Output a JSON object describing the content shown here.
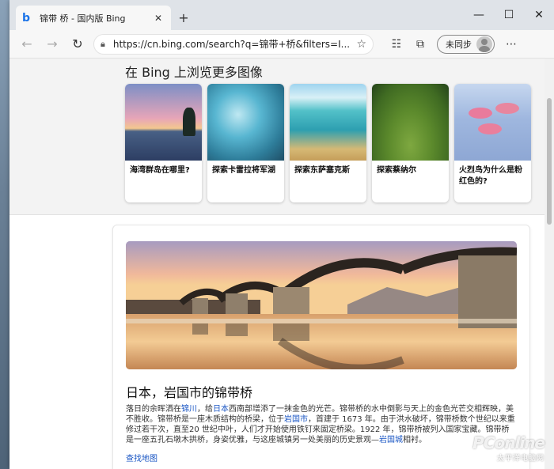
{
  "browser": {
    "tab_title": "锦带 桥 - 国内版 Bing",
    "new_tab": "+",
    "controls": {
      "minimize": "—",
      "maximize": "☐",
      "close": "✕"
    }
  },
  "toolbar": {
    "back": "←",
    "forward": "→",
    "refresh": "↻",
    "url_host": "https://cn.bing.com",
    "url_path": "/search?q=锦带+桥&filters=I...",
    "favorite": "☆",
    "collections": "☷",
    "tabs": "⧉",
    "profile_label": "未同步",
    "menu": "⋯"
  },
  "more_images": {
    "title": "在 Bing 上浏览更多图像",
    "cards": [
      {
        "caption": "海湾群岛在哪里?"
      },
      {
        "caption": "探索卡雷拉将军湖"
      },
      {
        "caption": "探索东萨塞克斯"
      },
      {
        "caption": "探索蔡纳尔"
      },
      {
        "caption": "火烈鸟为什么是粉红色的?"
      }
    ]
  },
  "feature": {
    "title": "日本，岩国市的锦带桥",
    "desc_1": "落日的余晖洒在",
    "link_1": "锦川",
    "desc_2": "，给",
    "link_2": "日本",
    "desc_3": "西南部增添了一抹金色的光芒。锦带桥的水中倒影与天上的金色光芒交相辉映，美不胜收。锦带桥是一座木质结构的桥梁，位于",
    "link_3": "岩国市",
    "desc_4": "，首建于 1673 年。由于洪水破坏，锦带桥数个世纪以来重修过若干次，直至20 世纪中叶，人们才开始使用铁钉来固定桥梁。1922 年，锦带桥被列入国家宝藏。锦带桥是一座五孔石墩木拱桥，身姿优雅，与这座城镇另一处美丽的历史景观—",
    "link_4": "岩国城",
    "desc_5": "相衬。",
    "map_link": "查找地图"
  },
  "watermark": {
    "brand": "PConline",
    "sub": "太平洋电脑网"
  }
}
